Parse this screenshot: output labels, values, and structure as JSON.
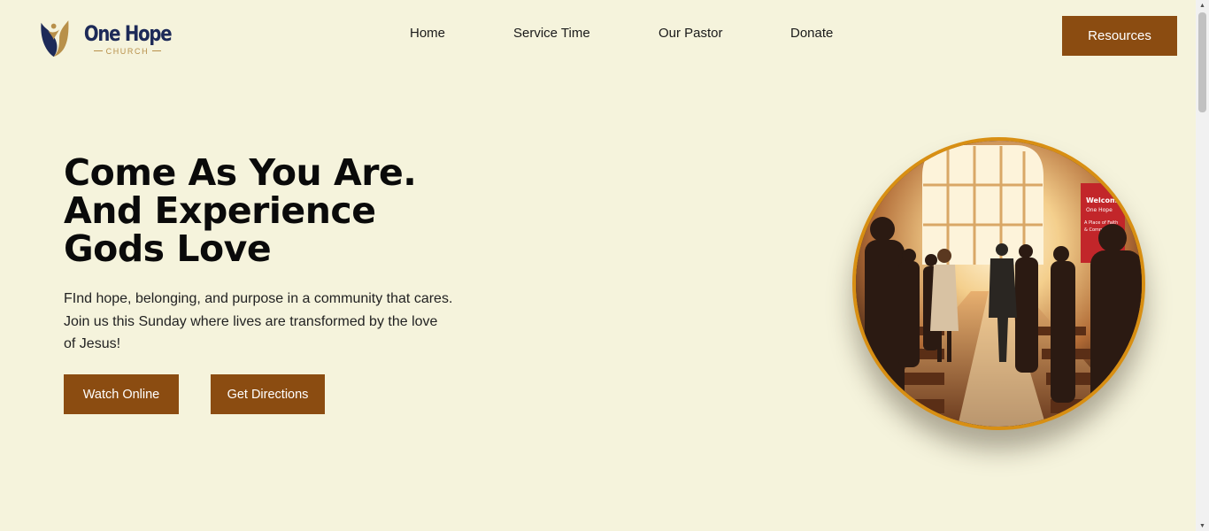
{
  "brand": {
    "name": "One Hope",
    "sub": "CHURCH",
    "colors": {
      "navy": "#1d2a58",
      "gold": "#b8904a"
    }
  },
  "nav": {
    "items": [
      {
        "label": "Home"
      },
      {
        "label": "Service Time"
      },
      {
        "label": "Our Pastor"
      },
      {
        "label": "Donate"
      }
    ],
    "resources_label": "Resources"
  },
  "hero": {
    "title_lines": [
      "Come As You Are.",
      "And Experience",
      "Gods Love"
    ],
    "description": "FInd hope, belonging, and purpose in a community that cares. Join us this Sunday where lives are transformed by the love of Jesus!",
    "watch_label": "Watch Online",
    "directions_label": "Get Directions",
    "image": {
      "banner_lines": [
        "Welcome",
        "One Hope",
        "A Place of Faith",
        "& Community"
      ],
      "ring_color": "#d88f13"
    }
  },
  "colors": {
    "background": "#f5f3dc",
    "accent": "#8b4c11"
  },
  "icons": {
    "scroll_up": "scroll-up-arrow-icon",
    "scroll_down": "scroll-down-arrow-icon"
  }
}
